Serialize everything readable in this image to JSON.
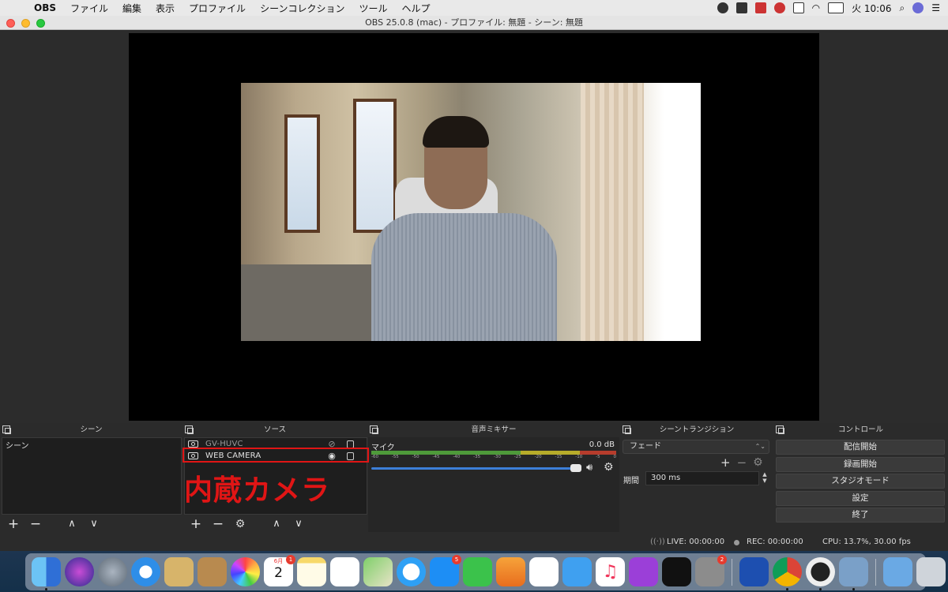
{
  "menubar": {
    "app_name": "OBS",
    "items": [
      "ファイル",
      "編集",
      "表示",
      "プロファイル",
      "シーンコレクション",
      "ツール",
      "ヘルプ"
    ],
    "clock": "火 10:06"
  },
  "window": {
    "title": "OBS 25.0.8 (mac) - プロファイル: 無題 - シーン: 無題"
  },
  "panels": {
    "scenes": {
      "title": "シーン",
      "items": [
        "シーン"
      ]
    },
    "sources": {
      "title": "ソース",
      "items": [
        {
          "name": "GV-HUVC",
          "visible": false
        },
        {
          "name": "WEB CAMERA",
          "visible": true
        }
      ]
    },
    "mixer": {
      "title": "音声ミキサー",
      "channel_label": "マイク",
      "db_value": "0.0 dB",
      "ticks": [
        "-60",
        "-55",
        "-50",
        "-45",
        "-40",
        "-35",
        "-30",
        "-25",
        "-20",
        "-15",
        "-10",
        "-5",
        "0"
      ]
    },
    "transitions": {
      "title": "シーントランジション",
      "selected": "フェード",
      "duration_label": "期間",
      "duration_value": "300 ms"
    },
    "controls": {
      "title": "コントロール",
      "buttons": [
        "配信開始",
        "録画開始",
        "スタジオモード",
        "設定",
        "終了"
      ]
    }
  },
  "annotation": {
    "text": "内蔵カメラ",
    "color": "#e01515"
  },
  "status": {
    "live": "LIVE: 00:00:00",
    "rec": "REC: 00:00:00",
    "cpu": "CPU: 13.7%, 30.00 fps"
  },
  "dock": {
    "calendar_month": "6月",
    "calendar_day": "2",
    "badges": {
      "calendar": "1",
      "appstore": "5",
      "prefs": "2"
    },
    "icons": [
      "finder-icon",
      "siri-icon",
      "launchpad-icon",
      "safari-icon",
      "mail-icon",
      "contacts-icon",
      "photos-icon",
      "calendar-icon",
      "notes-icon",
      "reminders-icon",
      "maps-icon",
      "messages-icon",
      "appstore-icon",
      "facetime-icon",
      "keynote-icon",
      "numbers-icon",
      "pages-icon",
      "music-icon",
      "podcasts-icon",
      "tv-icon",
      "prefs-icon",
      "wd-icon",
      "chrome-icon",
      "obs-icon",
      "preview-icon",
      "folder-icon",
      "trash-icon"
    ]
  }
}
